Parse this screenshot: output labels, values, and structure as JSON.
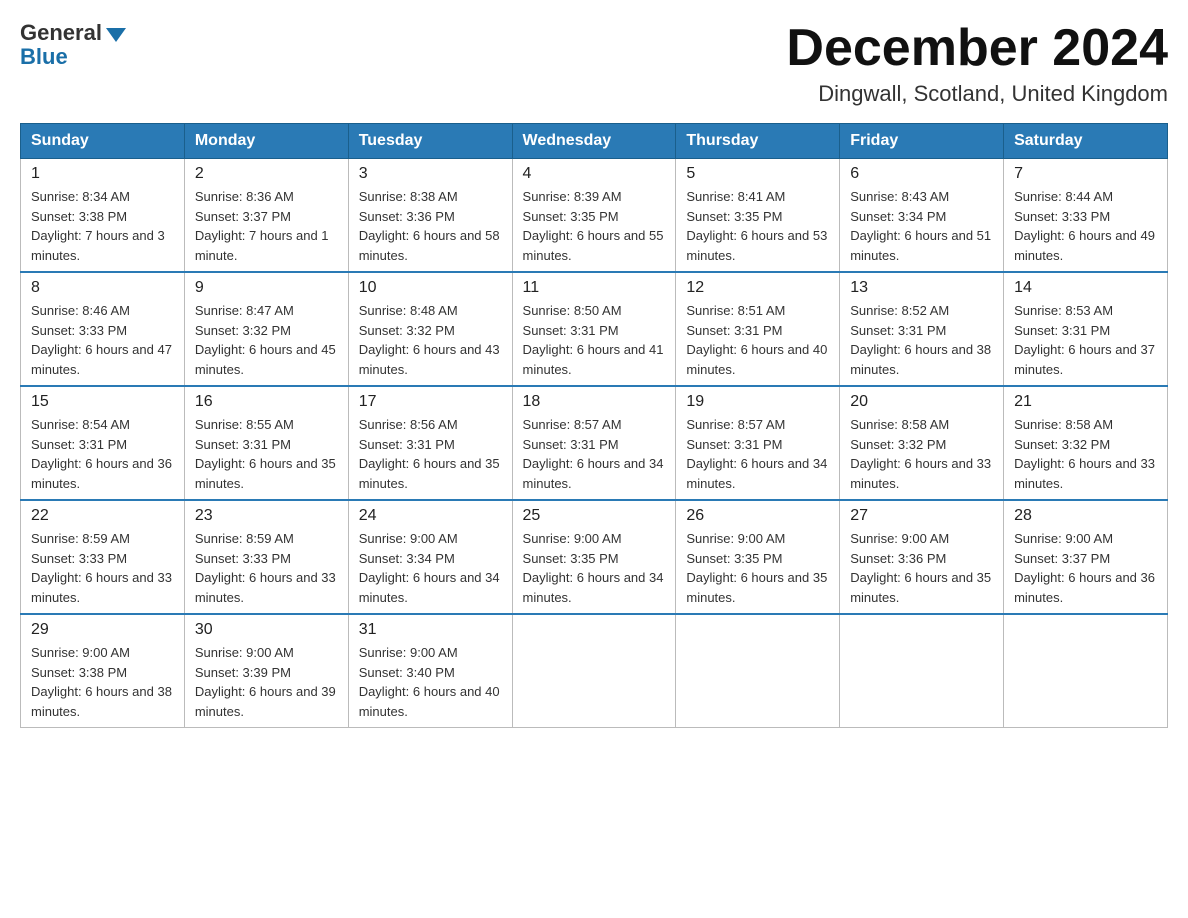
{
  "header": {
    "logo_general": "General",
    "logo_blue": "Blue",
    "month_title": "December 2024",
    "location": "Dingwall, Scotland, United Kingdom"
  },
  "weekdays": [
    "Sunday",
    "Monday",
    "Tuesday",
    "Wednesday",
    "Thursday",
    "Friday",
    "Saturday"
  ],
  "weeks": [
    [
      {
        "day": "1",
        "sunrise": "8:34 AM",
        "sunset": "3:38 PM",
        "daylight": "7 hours and 3 minutes."
      },
      {
        "day": "2",
        "sunrise": "8:36 AM",
        "sunset": "3:37 PM",
        "daylight": "7 hours and 1 minute."
      },
      {
        "day": "3",
        "sunrise": "8:38 AM",
        "sunset": "3:36 PM",
        "daylight": "6 hours and 58 minutes."
      },
      {
        "day": "4",
        "sunrise": "8:39 AM",
        "sunset": "3:35 PM",
        "daylight": "6 hours and 55 minutes."
      },
      {
        "day": "5",
        "sunrise": "8:41 AM",
        "sunset": "3:35 PM",
        "daylight": "6 hours and 53 minutes."
      },
      {
        "day": "6",
        "sunrise": "8:43 AM",
        "sunset": "3:34 PM",
        "daylight": "6 hours and 51 minutes."
      },
      {
        "day": "7",
        "sunrise": "8:44 AM",
        "sunset": "3:33 PM",
        "daylight": "6 hours and 49 minutes."
      }
    ],
    [
      {
        "day": "8",
        "sunrise": "8:46 AM",
        "sunset": "3:33 PM",
        "daylight": "6 hours and 47 minutes."
      },
      {
        "day": "9",
        "sunrise": "8:47 AM",
        "sunset": "3:32 PM",
        "daylight": "6 hours and 45 minutes."
      },
      {
        "day": "10",
        "sunrise": "8:48 AM",
        "sunset": "3:32 PM",
        "daylight": "6 hours and 43 minutes."
      },
      {
        "day": "11",
        "sunrise": "8:50 AM",
        "sunset": "3:31 PM",
        "daylight": "6 hours and 41 minutes."
      },
      {
        "day": "12",
        "sunrise": "8:51 AM",
        "sunset": "3:31 PM",
        "daylight": "6 hours and 40 minutes."
      },
      {
        "day": "13",
        "sunrise": "8:52 AM",
        "sunset": "3:31 PM",
        "daylight": "6 hours and 38 minutes."
      },
      {
        "day": "14",
        "sunrise": "8:53 AM",
        "sunset": "3:31 PM",
        "daylight": "6 hours and 37 minutes."
      }
    ],
    [
      {
        "day": "15",
        "sunrise": "8:54 AM",
        "sunset": "3:31 PM",
        "daylight": "6 hours and 36 minutes."
      },
      {
        "day": "16",
        "sunrise": "8:55 AM",
        "sunset": "3:31 PM",
        "daylight": "6 hours and 35 minutes."
      },
      {
        "day": "17",
        "sunrise": "8:56 AM",
        "sunset": "3:31 PM",
        "daylight": "6 hours and 35 minutes."
      },
      {
        "day": "18",
        "sunrise": "8:57 AM",
        "sunset": "3:31 PM",
        "daylight": "6 hours and 34 minutes."
      },
      {
        "day": "19",
        "sunrise": "8:57 AM",
        "sunset": "3:31 PM",
        "daylight": "6 hours and 34 minutes."
      },
      {
        "day": "20",
        "sunrise": "8:58 AM",
        "sunset": "3:32 PM",
        "daylight": "6 hours and 33 minutes."
      },
      {
        "day": "21",
        "sunrise": "8:58 AM",
        "sunset": "3:32 PM",
        "daylight": "6 hours and 33 minutes."
      }
    ],
    [
      {
        "day": "22",
        "sunrise": "8:59 AM",
        "sunset": "3:33 PM",
        "daylight": "6 hours and 33 minutes."
      },
      {
        "day": "23",
        "sunrise": "8:59 AM",
        "sunset": "3:33 PM",
        "daylight": "6 hours and 33 minutes."
      },
      {
        "day": "24",
        "sunrise": "9:00 AM",
        "sunset": "3:34 PM",
        "daylight": "6 hours and 34 minutes."
      },
      {
        "day": "25",
        "sunrise": "9:00 AM",
        "sunset": "3:35 PM",
        "daylight": "6 hours and 34 minutes."
      },
      {
        "day": "26",
        "sunrise": "9:00 AM",
        "sunset": "3:35 PM",
        "daylight": "6 hours and 35 minutes."
      },
      {
        "day": "27",
        "sunrise": "9:00 AM",
        "sunset": "3:36 PM",
        "daylight": "6 hours and 35 minutes."
      },
      {
        "day": "28",
        "sunrise": "9:00 AM",
        "sunset": "3:37 PM",
        "daylight": "6 hours and 36 minutes."
      }
    ],
    [
      {
        "day": "29",
        "sunrise": "9:00 AM",
        "sunset": "3:38 PM",
        "daylight": "6 hours and 38 minutes."
      },
      {
        "day": "30",
        "sunrise": "9:00 AM",
        "sunset": "3:39 PM",
        "daylight": "6 hours and 39 minutes."
      },
      {
        "day": "31",
        "sunrise": "9:00 AM",
        "sunset": "3:40 PM",
        "daylight": "6 hours and 40 minutes."
      },
      null,
      null,
      null,
      null
    ]
  ]
}
